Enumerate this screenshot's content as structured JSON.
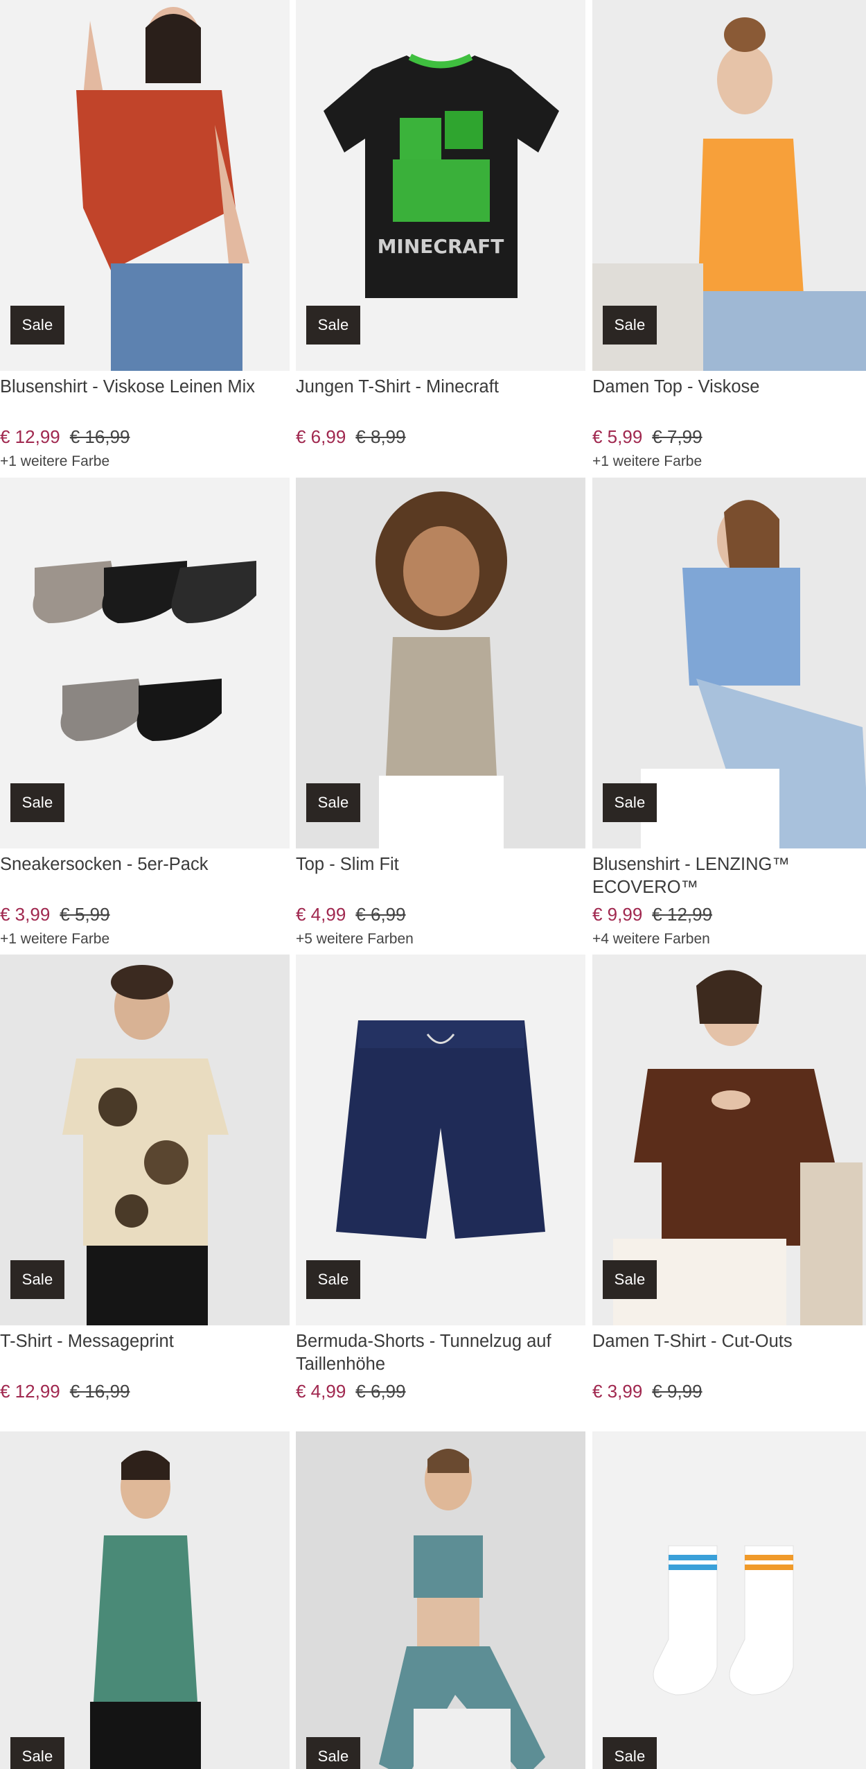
{
  "colors": {
    "price_now": "#a0284f",
    "sale_badge_bg": "#2b2623"
  },
  "products": [
    {
      "title": "Blusenshirt - Viskose Leinen Mix",
      "badge": "Sale",
      "price_now": "€ 12,99",
      "price_old": "€ 16,99",
      "variants": "+1 weitere Farbe",
      "image": "red-blouse-model"
    },
    {
      "title": "Jungen T-Shirt - Minecraft",
      "badge": "Sale",
      "price_now": "€ 6,99",
      "price_old": "€ 8,99",
      "variants": "",
      "image": "minecraft-tshirt",
      "print": "MINECRAFT"
    },
    {
      "title": "Damen Top - Viskose",
      "badge": "Sale",
      "price_now": "€ 5,99",
      "price_old": "€ 7,99",
      "variants": "+1 weitere Farbe",
      "image": "orange-top-model"
    },
    {
      "title": "Sneakersocken - 5er-Pack",
      "badge": "Sale",
      "price_now": "€ 3,99",
      "price_old": "€ 5,99",
      "variants": "+1 weitere Farbe",
      "image": "sneaker-socks"
    },
    {
      "title": "Top - Slim Fit",
      "badge": "Sale",
      "price_now": "€ 4,99",
      "price_old": "€ 6,99",
      "variants": "+5 weitere Farben",
      "image": "beige-top-model"
    },
    {
      "title": "Blusenshirt - LENZING™ ECOVERO™",
      "badge": "Sale",
      "price_now": "€ 9,99",
      "price_old": "€ 12,99",
      "variants": "+4 weitere Farben",
      "image": "blue-striped-blouse-model"
    },
    {
      "title": "T-Shirt - Messageprint",
      "badge": "Sale",
      "price_now": "€ 12,99",
      "price_old": "€ 16,99",
      "variants": "",
      "image": "tie-dye-tshirt-model"
    },
    {
      "title": "Bermuda-Shorts - Tunnelzug auf Taillenhöhe",
      "badge": "Sale",
      "price_now": "€ 4,99",
      "price_old": "€ 6,99",
      "variants": "",
      "image": "navy-shorts"
    },
    {
      "title": "Damen T-Shirt - Cut-Outs",
      "badge": "Sale",
      "price_now": "€ 3,99",
      "price_old": "€ 9,99",
      "variants": "",
      "image": "brown-cutout-tshirt-model"
    },
    {
      "title": "",
      "badge": "Sale",
      "price_now": "",
      "price_old": "",
      "variants": "",
      "image": "green-tank-top-model"
    },
    {
      "title": "",
      "badge": "Sale",
      "price_now": "",
      "price_old": "",
      "variants": "",
      "image": "teal-sport-set-model"
    },
    {
      "title": "",
      "badge": "Sale",
      "price_now": "",
      "price_old": "",
      "variants": "",
      "image": "white-sport-socks"
    }
  ]
}
